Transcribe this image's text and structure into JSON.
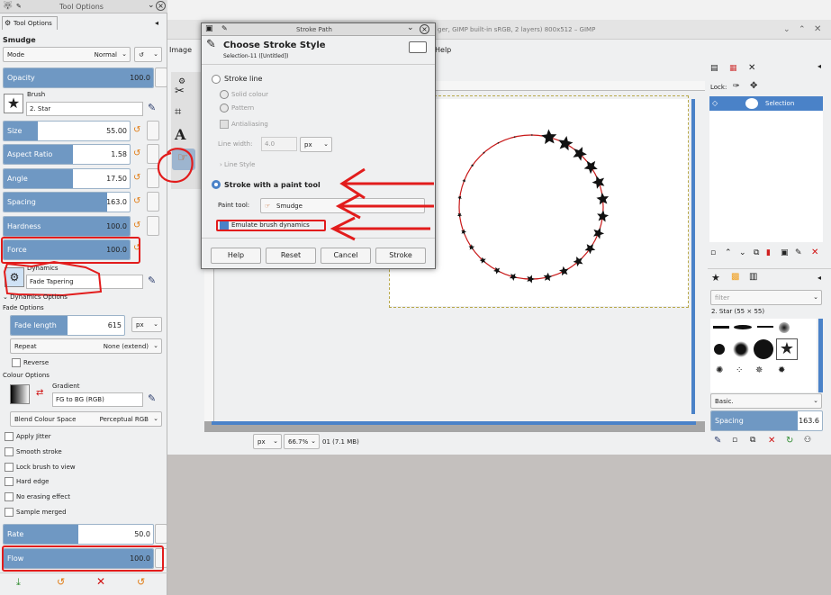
{
  "tool_options": {
    "title": "Tool Options",
    "tab_label": "Tool Options",
    "tool_name": "Smudge",
    "mode_label": "Mode",
    "mode_value": "Normal",
    "opacity": {
      "label": "Opacity",
      "value": "100.0",
      "fill": 1.0
    },
    "brush_label": "Brush",
    "brush_name": "2. Star",
    "size": {
      "label": "Size",
      "value": "55.00",
      "fill": 0.27
    },
    "aspect_ratio": {
      "label": "Aspect Ratio",
      "value": "1.58",
      "fill": 0.55
    },
    "angle": {
      "label": "Angle",
      "value": "17.50",
      "fill": 0.55
    },
    "spacing": {
      "label": "Spacing",
      "value": "163.0",
      "fill": 0.82
    },
    "hardness": {
      "label": "Hardness",
      "value": "100.0",
      "fill": 1.0
    },
    "force": {
      "label": "Force",
      "value": "100.0",
      "fill": 1.0
    },
    "dynamics_label": "Dynamics",
    "dynamics_value": "Fade Tapering",
    "dynamics_options": "Dynamics Options",
    "fade_options": "Fade Options",
    "fade_length": {
      "label": "Fade length",
      "value": "615",
      "fill": 0.5
    },
    "fade_unit": "px",
    "repeat_label": "Repeat",
    "repeat_value": "None (extend)",
    "reverse_label": "Reverse",
    "colour_options": "Colour Options",
    "gradient_label": "Gradient",
    "gradient_value": "FG to BG (RGB)",
    "blend_label": "Blend Colour Space",
    "blend_value": "Perceptual RGB",
    "checks": [
      "Apply Jitter",
      "Smooth stroke",
      "Lock brush to view",
      "Hard edge",
      "No erasing effect",
      "Sample merged"
    ],
    "rate": {
      "label": "Rate",
      "value": "50.0",
      "fill": 0.5
    },
    "flow": {
      "label": "Flow",
      "value": "100.0",
      "fill": 1.0
    }
  },
  "main": {
    "title_fragment": "ger, GIMP built-in sRGB, 2 layers) 800x512 – GIMP",
    "menu_image": "Image",
    "menu_help": "Help",
    "unit": "px",
    "zoom": "66.7%",
    "status": "01 (7.1 MB)"
  },
  "right_dock": {
    "lock_label": "Lock:",
    "path_name": "Selection",
    "filter_placeholder": "filter",
    "brush_info": "2. Star (55 × 55)",
    "brush_tag": "Basic.",
    "spacing_label": "Spacing",
    "spacing_value": "163.6"
  },
  "dialog": {
    "title": "Stroke Path",
    "heading": "Choose Stroke Style",
    "subheading": "Selection-11 ([Untitled])",
    "stroke_line": "Stroke line",
    "solid_colour": "Solid colour",
    "pattern": "Pattern",
    "antialiasing": "Antialiasing",
    "line_width_label": "Line width:",
    "line_width_value": "4.0",
    "line_width_unit": "px",
    "line_style": "Line Style",
    "stroke_paint": "Stroke with a paint tool",
    "paint_tool_label": "Paint tool:",
    "paint_tool_value": "Smudge",
    "emulate": "Emulate brush dynamics",
    "buttons": [
      "Help",
      "Reset",
      "Cancel",
      "Stroke"
    ]
  },
  "colors": {
    "accent": "#6f98c3",
    "annotation": "#e21c1c",
    "selected": "#4a82c8"
  }
}
